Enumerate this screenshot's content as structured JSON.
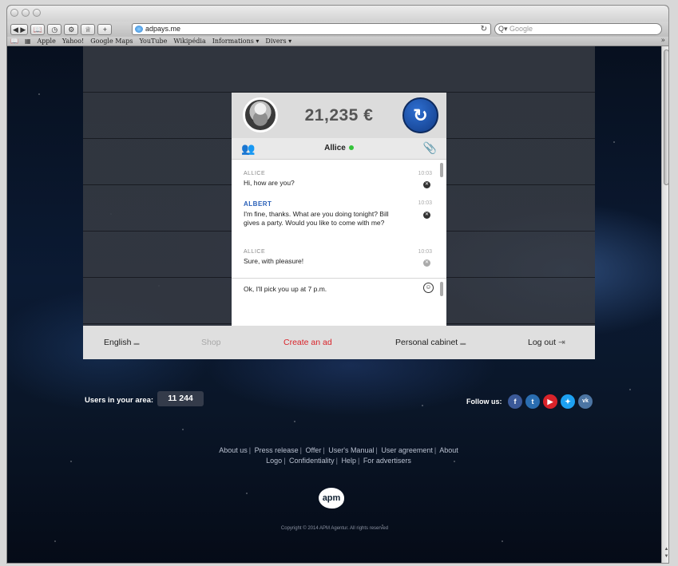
{
  "browser": {
    "url": "adpays.me",
    "search_placeholder": "Google",
    "bookmarks": [
      "Apple",
      "Yahoo!",
      "Google Maps",
      "YouTube",
      "Wikipédia",
      "Informations ▾",
      "Divers ▾"
    ]
  },
  "chat": {
    "balance": "21,235 €",
    "contact_name": "Allice",
    "messages": [
      {
        "sender": "ALLICE",
        "time": "10:03",
        "text": "Hi, how are you?"
      },
      {
        "sender": "ALBERT",
        "time": "10:03",
        "text": "I'm fine, thanks. What are you doing tonight? Bill gives a party. Would you like to come with me?"
      },
      {
        "sender": "ALLICE",
        "time": "10:03",
        "text": "Sure, with pleasure!"
      }
    ],
    "compose_text": "Ok, I'll pick you up at 7 p.m."
  },
  "nav": {
    "language": "English",
    "shop": "Shop",
    "create_ad": "Create an ad",
    "personal_cabinet": "Personal cabinet",
    "logout": "Log out"
  },
  "stats": {
    "users_label": "Users in your area:",
    "users_count": "11 244",
    "follow_label": "Follow us:"
  },
  "social": [
    {
      "glyph": "f",
      "color": "#3b5998"
    },
    {
      "glyph": "t",
      "color": "#2a6db0"
    },
    {
      "glyph": "▶",
      "color": "#d9232a"
    },
    {
      "glyph": "✦",
      "color": "#1da1f2"
    },
    {
      "glyph": "vk",
      "color": "#4c75a3"
    }
  ],
  "footer": {
    "links": [
      "About us",
      "Press release",
      "Offer",
      "User's Manual",
      "User agreement",
      "About",
      "Logo",
      "Confidentiality",
      "Help",
      "For advertisers"
    ],
    "logo_text": "apm",
    "copyright": "Copyright © 2014 APM Agentur. All rights reserved"
  }
}
